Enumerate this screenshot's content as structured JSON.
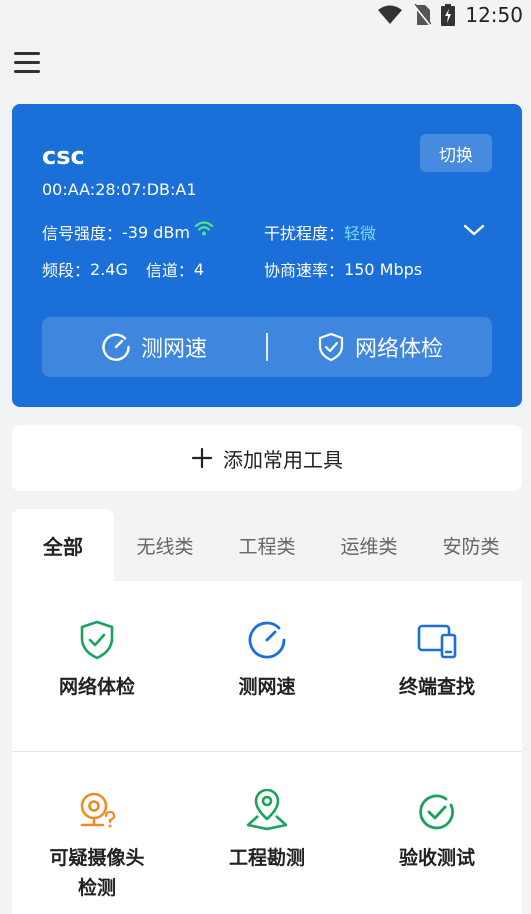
{
  "status_bar": {
    "time": "12:50"
  },
  "network": {
    "ssid": "csc",
    "mac": "00:AA:28:07:DB:A1",
    "switch_label": "切换",
    "signal_label": "信号强度：",
    "signal_value": "-39 dBm",
    "interference_label": "干扰程度：",
    "interference_value": "轻微",
    "band_label": "频段：",
    "band_value": "2.4G",
    "channel_label": "信道：",
    "channel_value": "4",
    "rate_label": "协商速率：",
    "rate_value": "150 Mbps",
    "speed_test_label": "测网速",
    "health_check_label": "网络体检"
  },
  "add_tools_label": "添加常用工具",
  "tabs": [
    {
      "label": "全部",
      "active": true
    },
    {
      "label": "无线类",
      "active": false
    },
    {
      "label": "工程类",
      "active": false
    },
    {
      "label": "运维类",
      "active": false
    },
    {
      "label": "安防类",
      "active": false
    }
  ],
  "tools": [
    {
      "label": "网络体检",
      "icon": "shield-check-icon",
      "color": "#1aa35a"
    },
    {
      "label": "测网速",
      "icon": "speedometer-icon",
      "color": "#1a6fd8"
    },
    {
      "label": "终端查找",
      "icon": "devices-icon",
      "color": "#1a6fd8"
    },
    {
      "label": "可疑摄像头检测",
      "icon": "camera-question-icon",
      "color": "#f08a24"
    },
    {
      "label": "工程勘测",
      "icon": "map-pin-icon",
      "color": "#1aa35a"
    },
    {
      "label": "验收测试",
      "icon": "check-circle-icon",
      "color": "#1aa35a"
    }
  ],
  "colors": {
    "primary": "#1a6fd8",
    "green": "#1aa35a",
    "orange": "#f08a24",
    "highlight": "#7fd8ff"
  }
}
